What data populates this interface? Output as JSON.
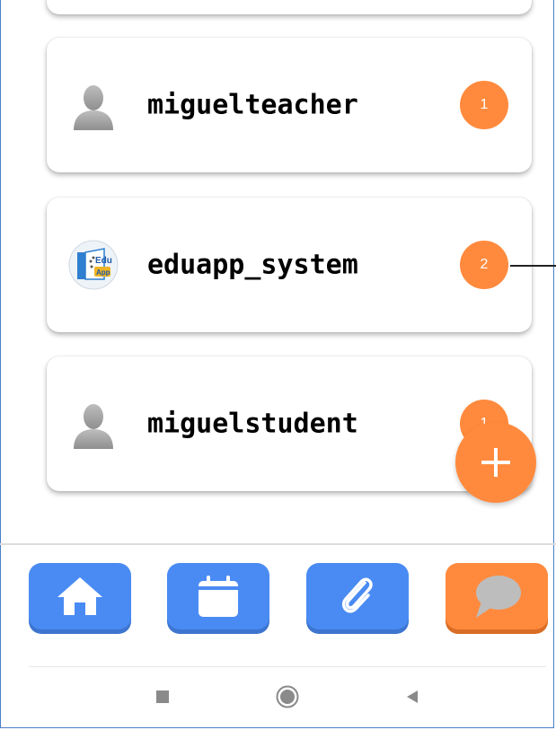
{
  "chats": [
    {
      "name": "miguelteacher",
      "unread": "1",
      "avatar": "user-silhouette-icon"
    },
    {
      "name": "eduapp_system",
      "unread": "2",
      "avatar": "eduapp-logo"
    },
    {
      "name": "miguelstudent",
      "unread": "1",
      "avatar": "user-silhouette-icon"
    }
  ],
  "logo_text": {
    "line1": "Edu",
    "line2": "App"
  },
  "fab": {
    "icon": "plus-icon"
  },
  "bottom_nav": [
    {
      "icon": "home-icon",
      "active": false
    },
    {
      "icon": "calendar-icon",
      "active": false
    },
    {
      "icon": "paperclip-icon",
      "active": false
    },
    {
      "icon": "chat-bubble-icon",
      "active": true
    }
  ],
  "system_nav": [
    "recents-icon",
    "home-circle-icon",
    "back-icon"
  ],
  "colors": {
    "accent": "#ff8a3d",
    "primary": "#4a8bf3"
  }
}
